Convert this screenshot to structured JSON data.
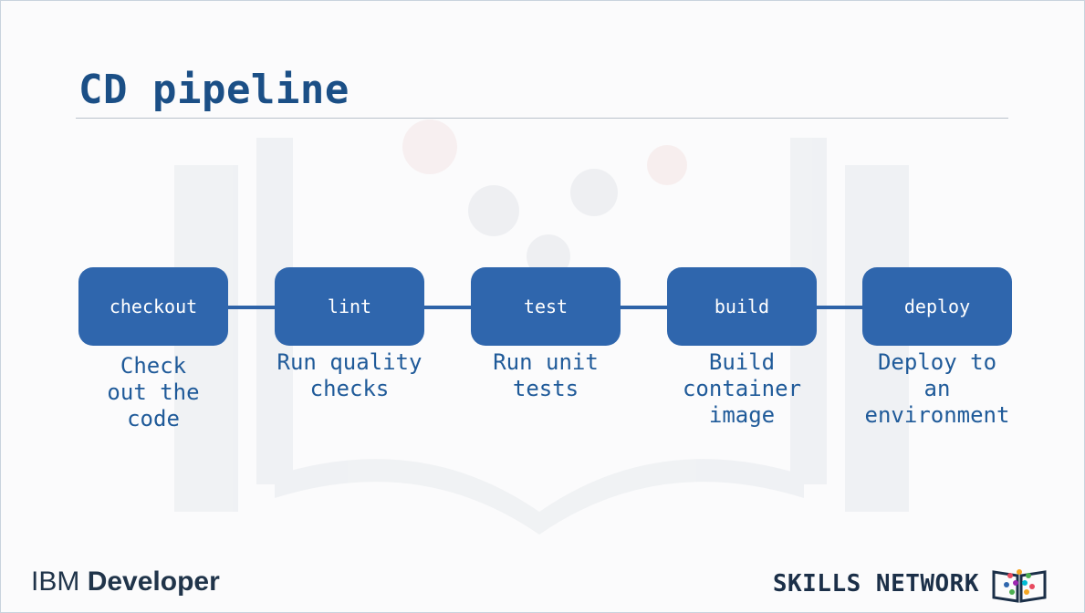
{
  "title": "CD pipeline",
  "stages": [
    {
      "label": "checkout",
      "description": "Check\nout the\ncode"
    },
    {
      "label": "lint",
      "description": "Run quality\nchecks"
    },
    {
      "label": "test",
      "description": "Run unit\ntests"
    },
    {
      "label": "build",
      "description": "Build\ncontainer\nimage"
    },
    {
      "label": "deploy",
      "description": "Deploy to\nan\nenvironment"
    }
  ],
  "footer": {
    "brand_prefix": "IBM",
    "brand_name": "Developer",
    "network": "SKILLS NETWORK",
    "logo_icon": "skills-network-book-icon"
  },
  "colors": {
    "title": "#1b4f86",
    "box": "#2f66ad",
    "connector": "#2e63a8",
    "description": "#1f5a99"
  }
}
